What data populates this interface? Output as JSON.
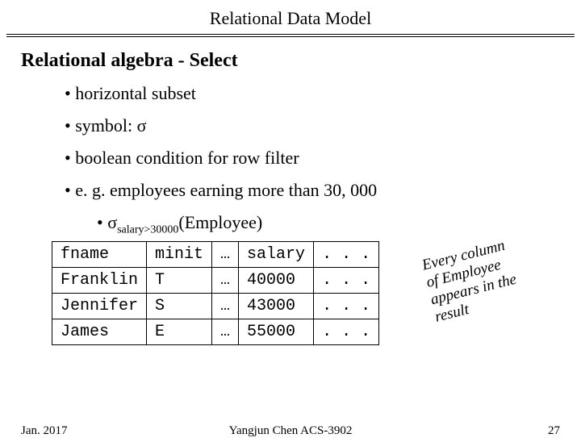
{
  "header": {
    "title": "Relational Data Model"
  },
  "subtitle": "Relational algebra - Select",
  "bullets": {
    "b1": "horizontal subset",
    "b2_prefix": "symbol: ",
    "b2_symbol": "σ",
    "b3": "boolean condition for row filter",
    "b4": "e. g. employees earning more than 30, 000",
    "expr_sigma": "σ",
    "expr_sub": "salary>30000",
    "expr_rest": "(Employee)"
  },
  "chart_data": {
    "type": "table",
    "columns": [
      "fname",
      "minit",
      "…",
      "salary",
      ". . ."
    ],
    "rows": [
      {
        "fname": "Franklin",
        "minit": "T",
        "dots1": "…",
        "salary": "40000",
        "dots2": ". . ."
      },
      {
        "fname": "Jennifer",
        "minit": "S",
        "dots1": "…",
        "salary": "43000",
        "dots2": ". . ."
      },
      {
        "fname": "James",
        "minit": "E",
        "dots1": "…",
        "salary": "55000",
        "dots2": ". . ."
      }
    ]
  },
  "note": {
    "l1": "Every column",
    "l2": "of Employee",
    "l3": "appears in the",
    "l4": "result"
  },
  "footer": {
    "date": "Jan. 2017",
    "center": "Yangjun Chen      ACS-3902",
    "page": "27"
  }
}
